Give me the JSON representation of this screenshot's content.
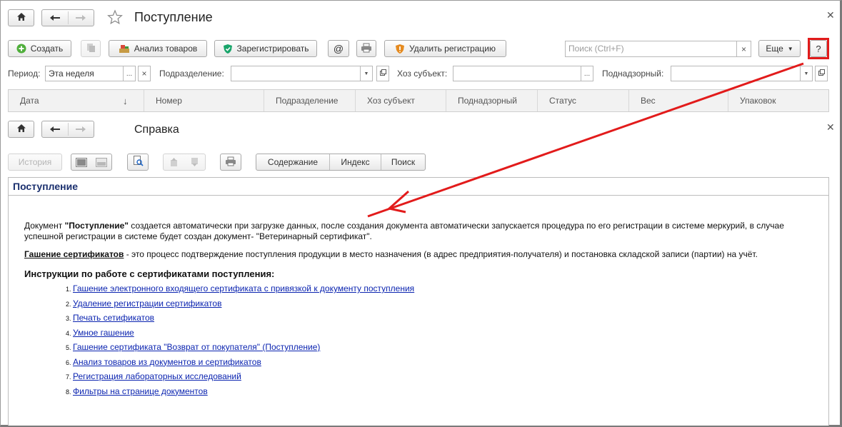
{
  "window": {
    "title": "Поступление"
  },
  "toolbar": {
    "create": "Создать",
    "analysis": "Анализ товаров",
    "register": "Зарегистрировать",
    "at": "@",
    "delete_reg": "Удалить регистрацию",
    "search_placeholder": "Поиск (Ctrl+F)",
    "clear": "×",
    "more": "Еще",
    "help": "?"
  },
  "filters": {
    "period_label": "Период:",
    "period_value": "Эта неделя",
    "period_pick": "...",
    "period_clear": "×",
    "division_label": "Подразделение:",
    "subject_label": "Хоз субъект:",
    "subject_pick": "...",
    "supervised_label": "Поднадзорный:"
  },
  "table": {
    "columns": [
      "Дата",
      "Номер",
      "Подразделение",
      "Хоз субъект",
      "Поднадзорный",
      "Статус",
      "Вес",
      "Упаковок"
    ],
    "sort_indicator": "↓"
  },
  "help": {
    "title": "Справка",
    "toolbar": {
      "history": "История",
      "contents": "Содержание",
      "index": "Индекс",
      "search": "Поиск"
    },
    "page_title": "Поступление",
    "para1_pre": "Документ ",
    "para1_bold": "\"Поступление\"",
    "para1_post": " создается автоматически при загрузке данных, после создания документа автоматически запускается процедура по его регистрации в системе меркурий, в случае успешной регистрации в системе будет создан документ- \"Ветеринарный сертификат\".",
    "para2_term": "Гашение сертификатов",
    "para2_post": " - это процесс подтверждение поступления продукции в место назначения (в адрес предприятия-получателя) и постановка складской записи (партии) на учёт.",
    "instructions_heading": "Инструкции по работе с сертификатами поступления:",
    "links": [
      "Гашение электронного входящего сертификата с привязкой к документу поступления",
      "Удаление регистрации сертификатов",
      "Печать сетификатов",
      "Умное гашение",
      "Гашение сертификата \"Возврат от покупателя\" (Поступление)",
      "Анализ товаров из документов и сертификатов",
      "Регистрация лабораторных исследований",
      "Фильтры на странице документов"
    ]
  },
  "colors": {
    "accent_red": "#e21b1b",
    "link_blue": "#0b24b0",
    "help_title": "#1a2f6e"
  }
}
